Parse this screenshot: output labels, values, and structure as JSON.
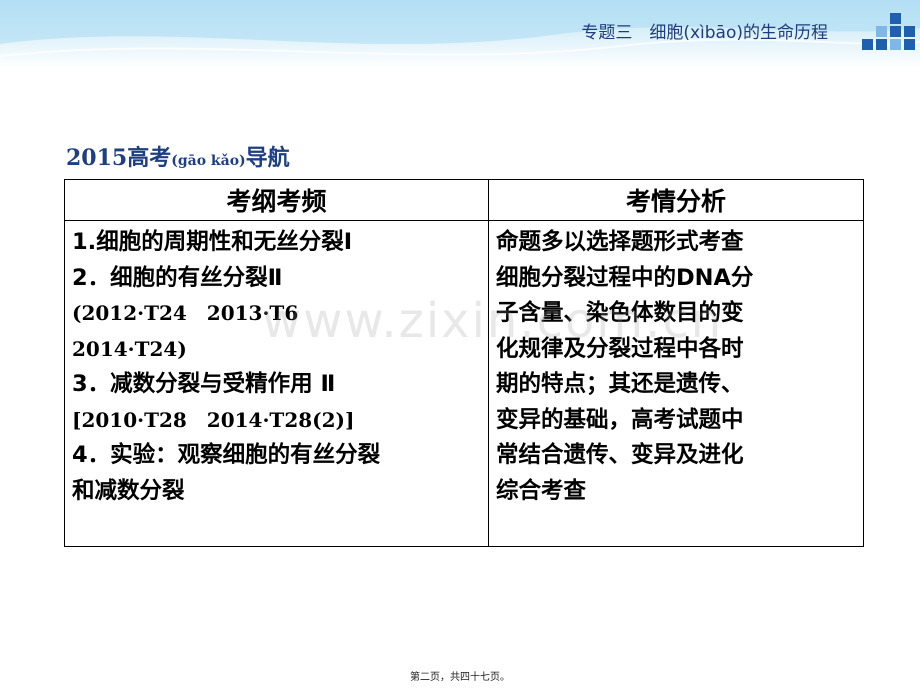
{
  "header": {
    "title": "专题三　细胞(xìbāo)的生命历程"
  },
  "section": {
    "title_main": "2015高考",
    "title_pinyin": "(gāo kǎo)",
    "title_suffix": "导航"
  },
  "table": {
    "headers": [
      "考纲考频",
      "考情分析"
    ],
    "left_lines": [
      "1.细胞的周期性和无丝分裂Ⅰ",
      "2．细胞的有丝分裂Ⅱ",
      "(2012·T24　2013·T6",
      "2014·T24)",
      "3．减数分裂与受精作用  Ⅱ",
      "[2010·T28　2014·T28(2)]",
      "4．实验：观察细胞的有丝分裂",
      "和减数分裂"
    ],
    "right_lines": [
      "命题多以选择题形式考查",
      "细胞分裂过程中的DNA分",
      "子含量、染色体数目的变",
      "化规律及分裂过程中各时",
      "期的特点；其还是遗传、",
      "变异的基础，高考试题中",
      "常结合遗传、变异及进化",
      "综合考查"
    ]
  },
  "watermark": "www.zixin.com.cn",
  "footer": "第二页，共四十七页。",
  "colors": {
    "banner": "#bfe4f6",
    "title": "#1f3f7f",
    "logo_dark": "#1f5fae",
    "logo_light": "#7fb8e6"
  }
}
